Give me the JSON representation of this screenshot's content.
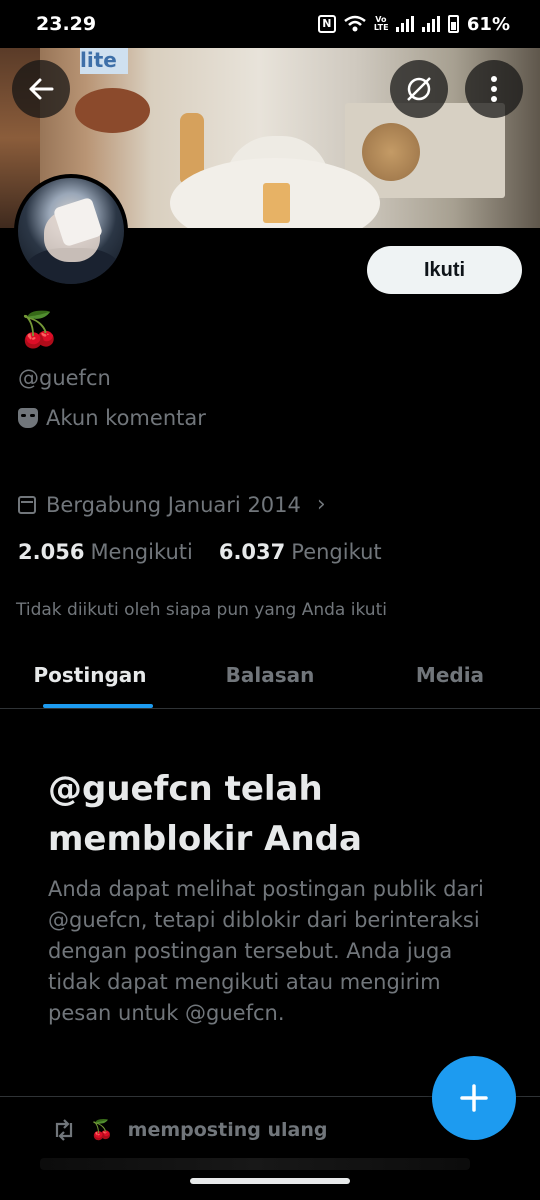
{
  "status_bar": {
    "time": "23.29",
    "battery": "61%"
  },
  "profile": {
    "display_name": "🍒",
    "handle": "@guefcn",
    "bio": "Akun komentar",
    "joined": "Bergabung Januari 2014",
    "following_count": "2.056",
    "following_label": "Mengikuti",
    "followers_count": "6.037",
    "followers_label": "Pengikut",
    "followed_by": "Tidak diikuti oleh siapa pun yang Anda ikuti"
  },
  "actions": {
    "follow_label": "Ikuti"
  },
  "tabs": [
    {
      "label": "Postingan",
      "active": true
    },
    {
      "label": "Balasan",
      "active": false
    },
    {
      "label": "Media",
      "active": false
    }
  ],
  "blocked": {
    "title": "@guefcn telah memblokir Anda",
    "message": "Anda dapat melihat postingan publik dari @guefcn, tetapi diblokir dari berinteraksi dengan postingan tersebut. Anda juga tidak dapat mengikuti atau mengirim pesan untuk @guefcn."
  },
  "repost": {
    "emoji": "🍒",
    "label": "memposting ulang"
  },
  "icons": [
    "back-arrow-icon",
    "grok-icon",
    "more-icon",
    "calendar-icon",
    "mask-icon",
    "chevron-right-icon",
    "repost-icon",
    "plus-icon"
  ],
  "colors": {
    "accent": "#1d9bf0",
    "background": "#000000",
    "muted_text": "#71767b"
  }
}
